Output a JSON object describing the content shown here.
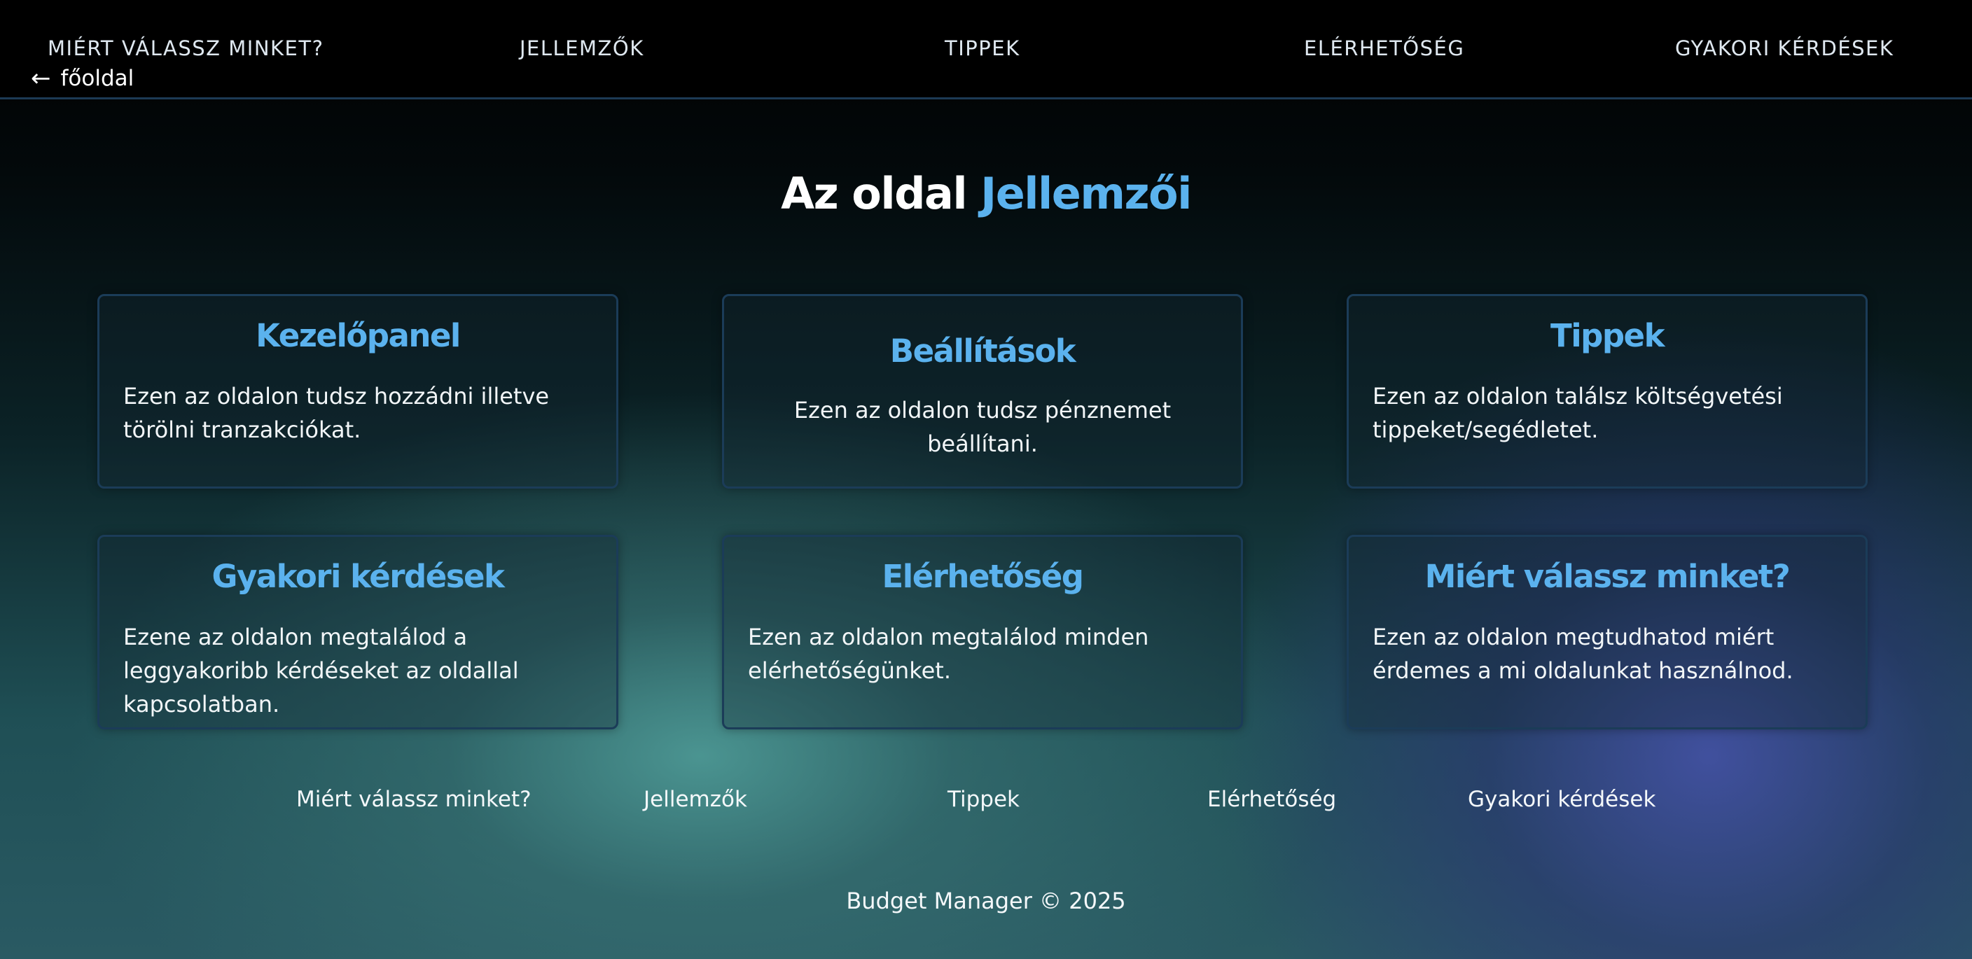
{
  "header": {
    "nav": [
      {
        "label": "MIÉRT VÁLASSZ MINKET?"
      },
      {
        "label": "JELLEMZŐK"
      },
      {
        "label": "TIPPEK"
      },
      {
        "label": "ELÉRHETŐSÉG"
      },
      {
        "label": "GYAKORI KÉRDÉSEK"
      }
    ],
    "back": {
      "arrow": "←",
      "label": "főoldal"
    }
  },
  "main": {
    "title_prefix": "Az oldal",
    "title_accent": "Jellemzői",
    "cards": [
      {
        "title": "Kezelőpanel",
        "text": "Ezen az oldalon tudsz hozzádni illetve törölni tranzakciókat."
      },
      {
        "title": "Beállítások",
        "text": "Ezen az oldalon tudsz pénznemet beállítani."
      },
      {
        "title": "Tippek",
        "text": "Ezen az oldalon találsz költségvetési tippeket/segédletet."
      },
      {
        "title": "Gyakori kérdések",
        "text": "Ezene az oldalon megtalálod a leggyakoribb kérdéseket az oldallal kapcsolatban."
      },
      {
        "title": "Elérhetőség",
        "text": "Ezen az oldalon megtalálod minden elérhetőségünket."
      },
      {
        "title": "Miért válassz minket?",
        "text": "Ezen az oldalon megtudhatod miért érdemes a mi oldalunkat használnod."
      }
    ]
  },
  "footer": {
    "links": [
      {
        "label": "Miért válassz minket?"
      },
      {
        "label": "Jellemzők"
      },
      {
        "label": "Tippek"
      },
      {
        "label": "Elérhetőség"
      },
      {
        "label": "Gyakori kérdések"
      }
    ],
    "copyright": "Budget Manager © 2025"
  },
  "colors": {
    "accent": "#5bb2ee",
    "card_border": "#1b3c58",
    "header_bg": "#000000"
  }
}
